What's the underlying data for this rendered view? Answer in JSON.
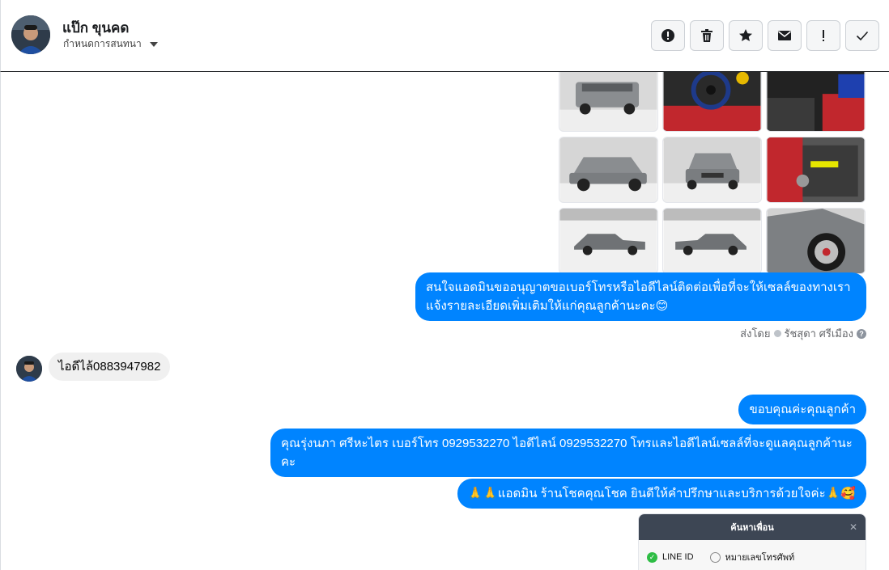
{
  "header": {
    "contact_name": "แป๊ก ขุนคด",
    "conversation_label": "กำหนดการสนทนา",
    "actions": [
      {
        "icon": "alert-circle-icon",
        "name": "mark-spam-button"
      },
      {
        "icon": "trash-icon",
        "name": "delete-button"
      },
      {
        "icon": "star-icon",
        "name": "star-button"
      },
      {
        "icon": "envelope-icon",
        "name": "mark-unread-button"
      },
      {
        "icon": "exclamation-icon",
        "name": "mark-important-button"
      },
      {
        "icon": "check-icon",
        "name": "mark-done-button"
      }
    ]
  },
  "messages": {
    "outgoing_1": "สนใจแอดมินขออนุญาตขอเบอร์โทรหรือไอดีไลน์ติดต่อเพื่อที่จะให้เซลล์ของทางเรา แจ้งรายละเอียดเพิ่มเติมให้แก่คุณลูกค้านะคะ😊",
    "sent_by_prefix": "ส่งโดย",
    "sent_by_name": "รัชสุดา ศรีเมือง",
    "incoming_1": "ไอดีไล้0883947982",
    "outgoing_2": "ขอบคุณค่ะคุณลูกค้า",
    "outgoing_3": "คุณรุ่งนภา ศรีหะไตร       เบอร์โทร 0929532270  ไอดีไลน์ 0929532270  โทรและไอดีไลน์เซลล์ที่จะดูแลคุณลูกค้านะคะ",
    "outgoing_4": "🙏🙏แอดมิน ร้านโชคคุณโชค ยินดีให้คำปรึกษาและบริการด้วยใจค่ะ🙏🥰"
  },
  "line_screenshot": {
    "title": "ค้นหาเพื่อน",
    "option_1": "LINE ID",
    "option_2": "หมายเลขโทรศัพท์"
  },
  "colors": {
    "outgoing_bubble": "#0084ff",
    "incoming_bubble": "#f0f0f0"
  }
}
